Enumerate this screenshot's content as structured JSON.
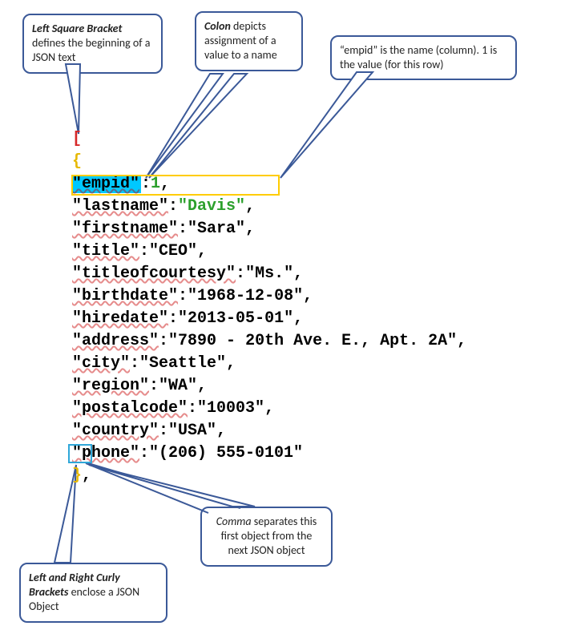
{
  "callouts": {
    "left_bracket": {
      "bold": "Left Square Bracket",
      "rest": " defines the beginning of a JSON text"
    },
    "colon": {
      "bold": "Colon",
      "rest": " depicts assignment of a value to a name"
    },
    "empid": {
      "text": "“empid” is the name (column). 1 is the value (for this row)"
    },
    "curly": {
      "bold": "Left and Right Curly Brackets",
      "rest": " enclose a JSON Object"
    },
    "comma": {
      "bold": "Comma",
      "rest": " separates this first object from the next JSON object"
    }
  },
  "json_code": {
    "open_array": "[",
    "open_obj": "{",
    "rows": [
      {
        "key": "\"empid\"",
        "value": "1",
        "value_type": "num",
        "highlight": true
      },
      {
        "key": "\"lastname\"",
        "value": "\"Davis\"",
        "value_type": "green"
      },
      {
        "key": "\"firstname\"",
        "value": "\"Sara\"",
        "value_type": "str"
      },
      {
        "key": "\"title\"",
        "value": "\"CEO\"",
        "value_type": "str"
      },
      {
        "key": "\"titleofcourtesy\"",
        "value": "\"Ms.\"",
        "value_type": "str"
      },
      {
        "key": "\"birthdate\"",
        "value": "\"1968-12-08\"",
        "value_type": "str"
      },
      {
        "key": "\"hiredate\"",
        "value": "\"2013-05-01\"",
        "value_type": "str"
      },
      {
        "key": "\"address\"",
        "value": "\"7890 - 20th Ave. E., Apt. 2A\"",
        "value_type": "str"
      },
      {
        "key": "\"city\"",
        "value": "\"Seattle\"",
        "value_type": "str"
      },
      {
        "key": "\"region\"",
        "value": "\"WA\"",
        "value_type": "str"
      },
      {
        "key": "\"postalcode\"",
        "value": "\"10003\"",
        "value_type": "str"
      },
      {
        "key": "\"country\"",
        "value": "\"USA\"",
        "value_type": "str"
      },
      {
        "key": "\"phone\"",
        "value": "\"(206) 555-0101\"",
        "value_type": "str",
        "last": true
      }
    ],
    "close_obj": "}",
    "obj_comma": ","
  }
}
